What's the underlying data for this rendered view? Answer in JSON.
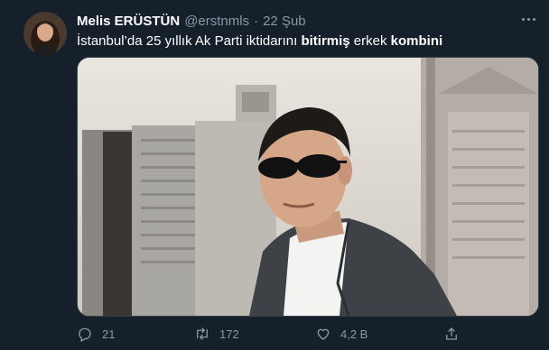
{
  "tweet": {
    "author_name": "Melis ERÜSTÜN",
    "handle": "@erstnmls",
    "separator": "·",
    "date": "22 Şub",
    "text_parts": [
      {
        "text": "İstanbul’da 25 yıllık Ak Parti iktidarını ",
        "bold": false
      },
      {
        "text": "bitirmiş",
        "bold": true
      },
      {
        "text": " erkek ",
        "bold": false
      },
      {
        "text": "kombini",
        "bold": true
      }
    ]
  },
  "actions": {
    "reply_count": "21",
    "retweet_count": "172",
    "like_count": "4,2 B"
  },
  "icons": {
    "more": "more-horizontal-icon",
    "reply": "comment-icon",
    "retweet": "retweet-icon",
    "like": "heart-icon",
    "share": "share-icon"
  },
  "colors": {
    "background": "#15202b",
    "secondary_text": "#8899a6",
    "primary_text": "#ffffff"
  }
}
